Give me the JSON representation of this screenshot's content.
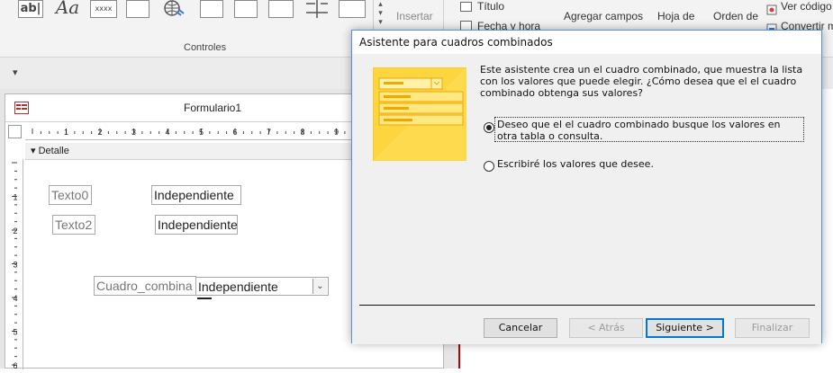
{
  "ribbon": {
    "controls": [
      "ab|",
      "Aa",
      "xxxx"
    ],
    "insert_label": "Insertar",
    "titulo_label": "Título",
    "fecha_label": "Fecha y hora",
    "agregar_campos_label": "Agregar campos",
    "hoja_label": "Hoja de",
    "orden_label": "Orden de",
    "ver_codigo_label": "Ver código",
    "convertir_label": "Convertir macros",
    "group_label": "Controles"
  },
  "form": {
    "title": "Formulario1",
    "section_label": "Detalle",
    "ruler_h": [
      "1",
      "2",
      "3",
      "4",
      "5",
      "6",
      "7",
      "8",
      "9"
    ],
    "ruler_v": [
      "1",
      "2",
      "3",
      "4",
      "5",
      "6"
    ],
    "controls": {
      "texto0_label": "Texto0",
      "texto0_value": "Independiente",
      "texto2_label": "Texto2",
      "texto2_value": "Independiente",
      "combo_label": "Cuadro_combina",
      "combo_value": "Independiente"
    }
  },
  "dialog": {
    "title": "Asistente para cuadros combinados",
    "description": "Este asistente crea un el cuadro combinado, que muestra la lista con los valores que puede elegir. ¿Cómo desea que el el cuadro combinado obtenga sus valores?",
    "option1": "Deseo que el el cuadro combinado busque los valores en otra tabla o consulta.",
    "option2": "Escribiré los valores que desee.",
    "selected_option": 1,
    "buttons": {
      "cancel": "Cancelar",
      "back": "< Atrás",
      "next": "Siguiente >",
      "finish": "Finalizar"
    },
    "accent_color": "#ffd740"
  }
}
